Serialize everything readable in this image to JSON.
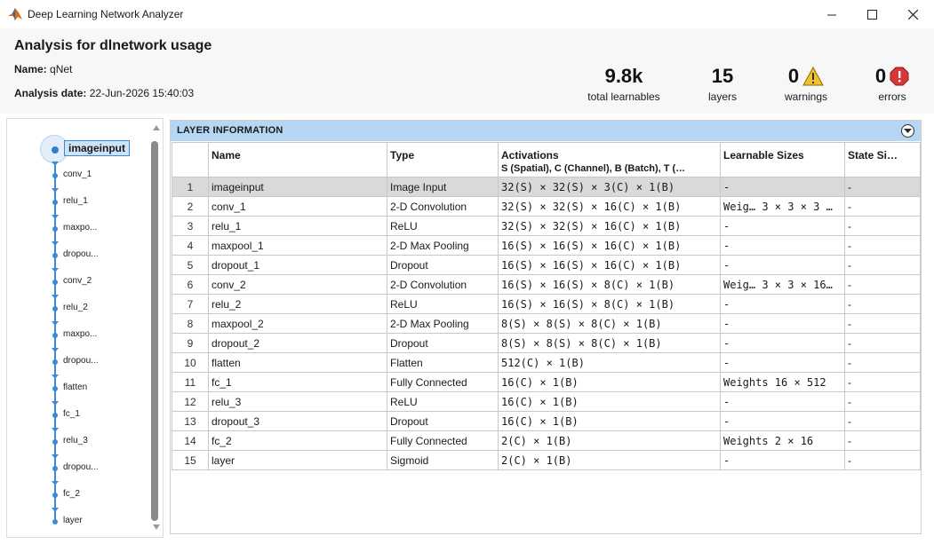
{
  "window": {
    "title": "Deep Learning Network Analyzer"
  },
  "header": {
    "title": "Analysis for dlnetwork usage",
    "name_label": "Name:",
    "name_value": "qNet",
    "date_label": "Analysis date:",
    "date_value": "22-Jun-2026 15:40:03"
  },
  "stats": {
    "learnables": {
      "value": "9.8k",
      "label": "total learnables"
    },
    "layers": {
      "value": "15",
      "label": "layers"
    },
    "warnings": {
      "value": "0",
      "label": "warnings"
    },
    "errors": {
      "value": "0",
      "label": "errors"
    }
  },
  "graph": {
    "selected": "imageinput",
    "nodes": [
      "conv_1",
      "relu_1",
      "maxpo...",
      "dropou...",
      "conv_2",
      "relu_2",
      "maxpo...",
      "dropou...",
      "flatten",
      "fc_1",
      "relu_3",
      "dropou...",
      "fc_2",
      "layer"
    ]
  },
  "layer_info": {
    "title": "LAYER INFORMATION",
    "columns": {
      "name": "Name",
      "type": "Type",
      "activations": "Activations",
      "activations_sub": "S (Spatial), C (Channel), B (Batch), T (…",
      "learnable": "Learnable Sizes",
      "state": "State Si…"
    },
    "rows": [
      {
        "idx": "1",
        "name": "imageinput",
        "type": "Image Input",
        "act": "32(S) × 32(S) × 3(C) × 1(B)",
        "learn": "-",
        "state": "-"
      },
      {
        "idx": "2",
        "name": "conv_1",
        "type": "2-D Convolution",
        "act": "32(S) × 32(S) × 16(C) × 1(B)",
        "learn": "Weig…  3 × 3 × 3 …",
        "state": "-"
      },
      {
        "idx": "3",
        "name": "relu_1",
        "type": "ReLU",
        "act": "32(S) × 32(S) × 16(C) × 1(B)",
        "learn": "-",
        "state": "-"
      },
      {
        "idx": "4",
        "name": "maxpool_1",
        "type": "2-D Max Pooling",
        "act": "16(S) × 16(S) × 16(C) × 1(B)",
        "learn": "-",
        "state": "-"
      },
      {
        "idx": "5",
        "name": "dropout_1",
        "type": "Dropout",
        "act": "16(S) × 16(S) × 16(C) × 1(B)",
        "learn": "-",
        "state": "-"
      },
      {
        "idx": "6",
        "name": "conv_2",
        "type": "2-D Convolution",
        "act": "16(S) × 16(S) × 8(C) × 1(B)",
        "learn": "Weig…  3 × 3 × 16…",
        "state": "-"
      },
      {
        "idx": "7",
        "name": "relu_2",
        "type": "ReLU",
        "act": "16(S) × 16(S) × 8(C) × 1(B)",
        "learn": "-",
        "state": "-"
      },
      {
        "idx": "8",
        "name": "maxpool_2",
        "type": "2-D Max Pooling",
        "act": "8(S) × 8(S) × 8(C) × 1(B)",
        "learn": "-",
        "state": "-"
      },
      {
        "idx": "9",
        "name": "dropout_2",
        "type": "Dropout",
        "act": "8(S) × 8(S) × 8(C) × 1(B)",
        "learn": "-",
        "state": "-"
      },
      {
        "idx": "10",
        "name": "flatten",
        "type": "Flatten",
        "act": "512(C) × 1(B)",
        "learn": "-",
        "state": "-"
      },
      {
        "idx": "11",
        "name": "fc_1",
        "type": "Fully Connected",
        "act": "16(C) × 1(B)",
        "learn": "Weights  16 × 512",
        "state": "-"
      },
      {
        "idx": "12",
        "name": "relu_3",
        "type": "ReLU",
        "act": "16(C) × 1(B)",
        "learn": "-",
        "state": "-"
      },
      {
        "idx": "13",
        "name": "dropout_3",
        "type": "Dropout",
        "act": "16(C) × 1(B)",
        "learn": "-",
        "state": "-"
      },
      {
        "idx": "14",
        "name": "fc_2",
        "type": "Fully Connected",
        "act": "2(C) × 1(B)",
        "learn": "Weights  2 × 16",
        "state": "-"
      },
      {
        "idx": "15",
        "name": "layer",
        "type": "Sigmoid",
        "act": "2(C) × 1(B)",
        "learn": "-",
        "state": "-"
      }
    ]
  },
  "colors": {
    "header_bg": "#b6d7f3",
    "graph_accent": "#3b8ad9",
    "selected_row": "#d9d9d9",
    "warning": "#f2c12e",
    "error": "#d93636"
  }
}
